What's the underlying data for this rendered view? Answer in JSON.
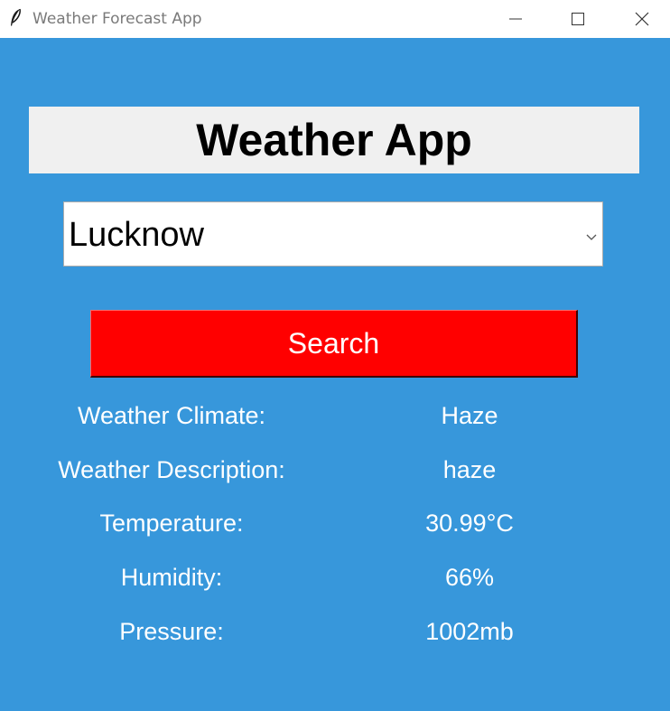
{
  "window": {
    "title": "Weather Forecast App"
  },
  "header": {
    "title": "Weather App"
  },
  "city_select": {
    "value": "Lucknow"
  },
  "search": {
    "label": "Search"
  },
  "info": {
    "rows": [
      {
        "label": "Weather Climate:",
        "value": "Haze"
      },
      {
        "label": "Weather Description:",
        "value": "haze"
      },
      {
        "label": "Temperature:",
        "value": "30.99°C"
      },
      {
        "label": "Humidity:",
        "value": "66%"
      },
      {
        "label": "Pressure:",
        "value": "1002mb"
      }
    ]
  },
  "colors": {
    "background": "#3797db",
    "search_button": "#ff0000",
    "header_box": "#f0f0f0"
  },
  "icons": {
    "app": "feather-icon",
    "minimize": "minimize-icon",
    "maximize": "maximize-icon",
    "close": "close-icon",
    "dropdown": "chevron-down-icon"
  }
}
